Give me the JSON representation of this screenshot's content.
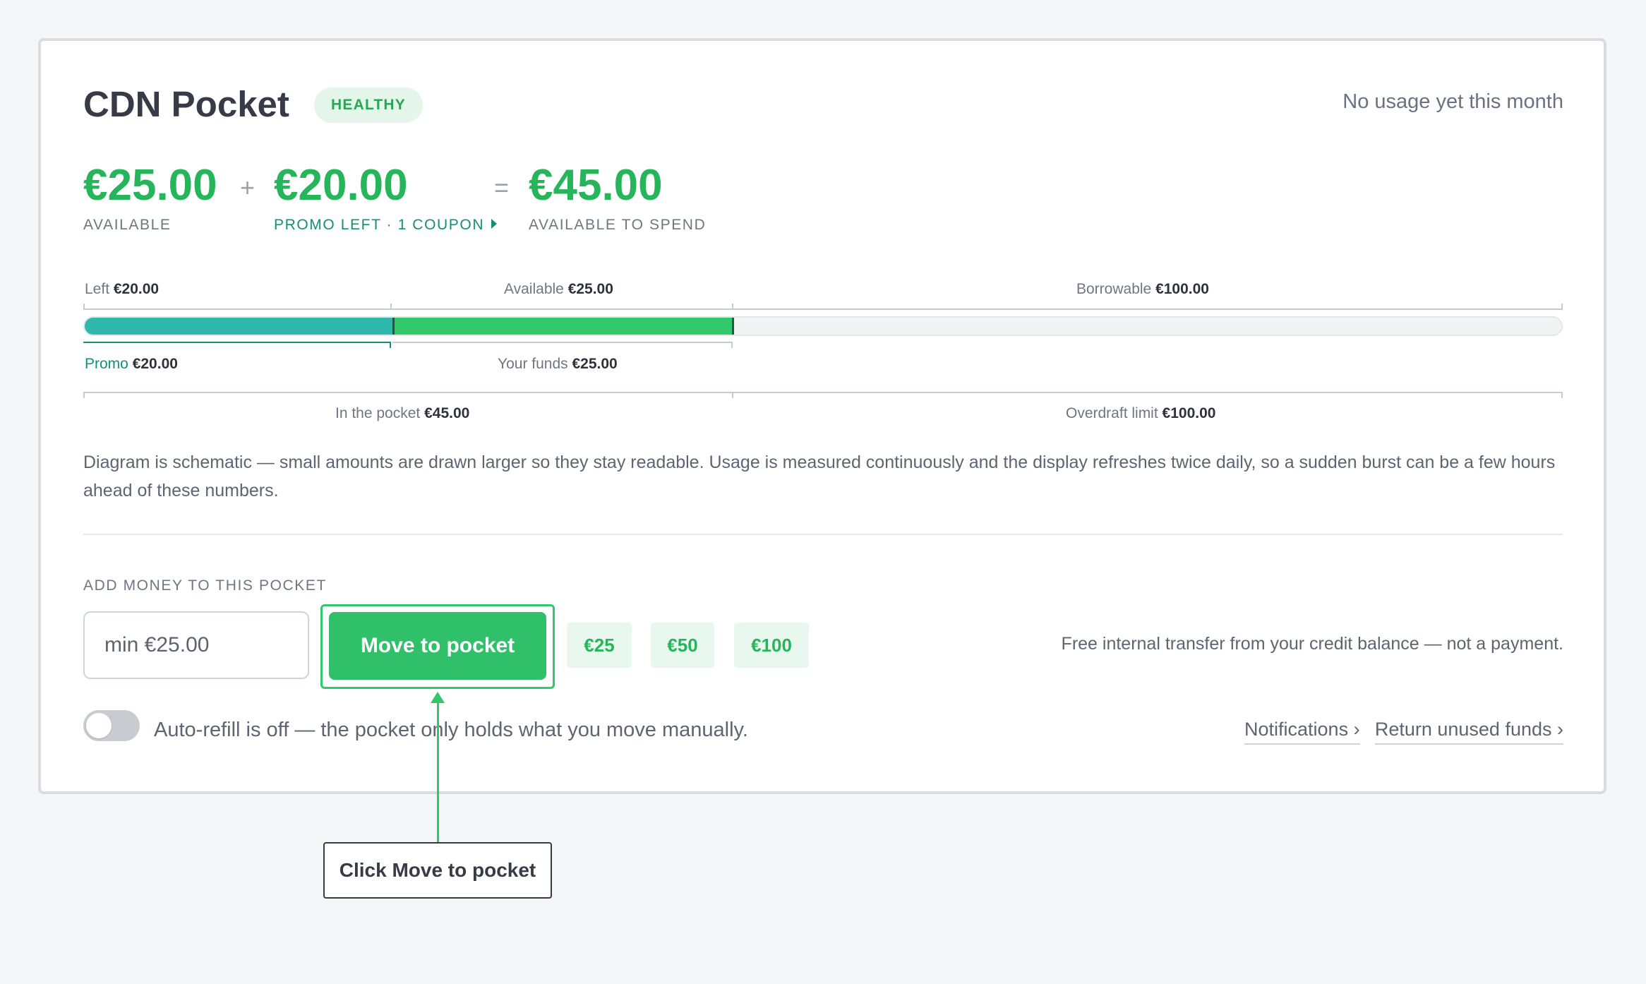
{
  "header": {
    "title": "CDN Pocket",
    "status_badge": "HEALTHY",
    "usage_note": "No usage yet this month"
  },
  "summary": {
    "available_amount": "€25.00",
    "available_label": "AVAILABLE",
    "plus": "+",
    "promo_amount": "€20.00",
    "promo_label": "PROMO LEFT · 1 COUPON",
    "equals": "=",
    "total_amount": "€45.00",
    "total_label": "AVAILABLE TO SPEND"
  },
  "diagram": {
    "top_labels": {
      "left": {
        "text": "Left",
        "value": "€20.00"
      },
      "available": {
        "text": "Available",
        "value": "€25.00"
      },
      "borrowable": {
        "text": "Borrowable",
        "value": "€100.00"
      }
    },
    "bottom_labels": {
      "promo": {
        "text": "Promo",
        "value": "€20.00"
      },
      "your_funds": {
        "text": "Your funds",
        "value": "€25.00"
      }
    },
    "range_labels": {
      "in_pocket": {
        "text": "In the pocket",
        "value": "€45.00"
      },
      "overdraft": {
        "text": "Overdraft limit",
        "value": "€100.00"
      }
    },
    "promo_fraction": 0.209,
    "funds_fraction": 0.23,
    "colors": {
      "promo": "#2fb9ac",
      "funds": "#31c76b",
      "track": "#f1f3f5"
    },
    "note": "Diagram is schematic — small amounts are drawn larger so they stay readable. Usage is measured continuously and the display refreshes twice daily, so a sudden burst can be a few hours ahead of these numbers."
  },
  "add_money": {
    "section_label": "ADD MONEY TO THIS POCKET",
    "amount_placeholder": "min €25.00",
    "move_button": "Move to pocket",
    "quick_amounts": [
      "€25",
      "€50",
      "€100"
    ],
    "transfer_note": "Free internal transfer from your credit balance — not a payment."
  },
  "autorefill": {
    "enabled": false,
    "label": "Auto-refill is off — the pocket only holds what you move manually."
  },
  "links": {
    "notifications": "Notifications ›",
    "return_funds": "Return unused funds ›"
  },
  "callout": {
    "text": "Click Move to pocket"
  },
  "theme": {
    "accent_green": "#31c76b",
    "teal": "#138f76"
  }
}
